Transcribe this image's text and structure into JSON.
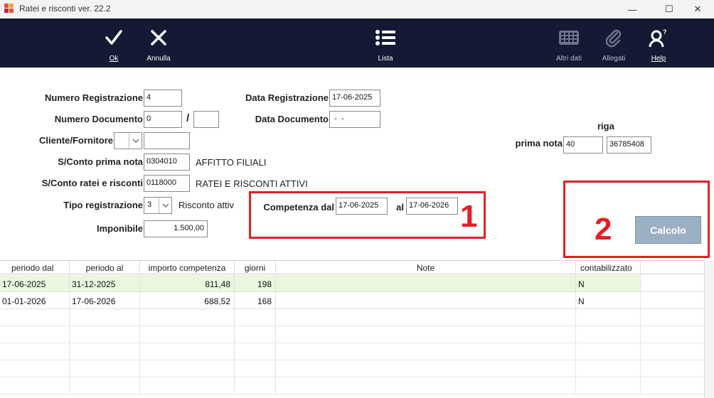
{
  "window": {
    "title": "Ratei e risconti  ver. 22.2",
    "minimize": "—",
    "maximize": "☐",
    "close": "✕"
  },
  "toolbar": {
    "ok": "Ok",
    "annulla": "Annulla",
    "lista": "Lista",
    "altri_dati": "Altri dati",
    "allegati": "Allegati",
    "help": "Help"
  },
  "form": {
    "numero_registrazione": {
      "label": "Numero Registrazione",
      "value": "4"
    },
    "data_registrazione": {
      "label": "Data Registrazione",
      "value": "17-06-2025"
    },
    "numero_documento": {
      "label": "Numero Documento",
      "value": "0",
      "suffix": "",
      "separator": "/"
    },
    "data_documento": {
      "label": "Data Documento",
      "value": " -  -"
    },
    "cliente_fornitore": {
      "label": "Cliente/Fornitore",
      "type": "",
      "value": ""
    },
    "riga_label": "riga",
    "prima_nota": {
      "label": "prima nota",
      "value": "40",
      "riga": "36785408"
    },
    "sconto_prima_nota": {
      "label": "S/Conto prima nota",
      "code": "0304010",
      "description": "AFFITTO FILIALI"
    },
    "sconto_ratei": {
      "label": "S/Conto ratei e risconti",
      "code": "0118000",
      "description": "RATEI E RISCONTI ATTIVI"
    },
    "tipo_registrazione": {
      "label": "Tipo registrazione",
      "value": "3",
      "description": "Risconto attiv"
    },
    "imponibile": {
      "label": "Imponibile",
      "value": "1.500,00"
    },
    "competenza": {
      "label_dal": "Competenza dal",
      "dal": "17-06-2025",
      "label_al": "al",
      "al": "17-06-2026"
    }
  },
  "annotations": {
    "one": "1",
    "two": "2"
  },
  "calcolo_label": "Calcolo",
  "grid": {
    "headers": [
      "periodo dal",
      "periodo al",
      "importo competenza",
      "giorni",
      "Note",
      "contabilizzato"
    ],
    "rows": [
      [
        "17-06-2025",
        "31-12-2025",
        "811,48",
        "198",
        "",
        "N"
      ],
      [
        "01-01-2026",
        "17-06-2026",
        "688,52",
        "168",
        "",
        "N"
      ]
    ]
  },
  "colors": {
    "toolbar_bg": "#141a33",
    "selected_row": "#e9f7dd",
    "annotation_red": "#e41f26",
    "calc_button": "#9cb0c4"
  }
}
